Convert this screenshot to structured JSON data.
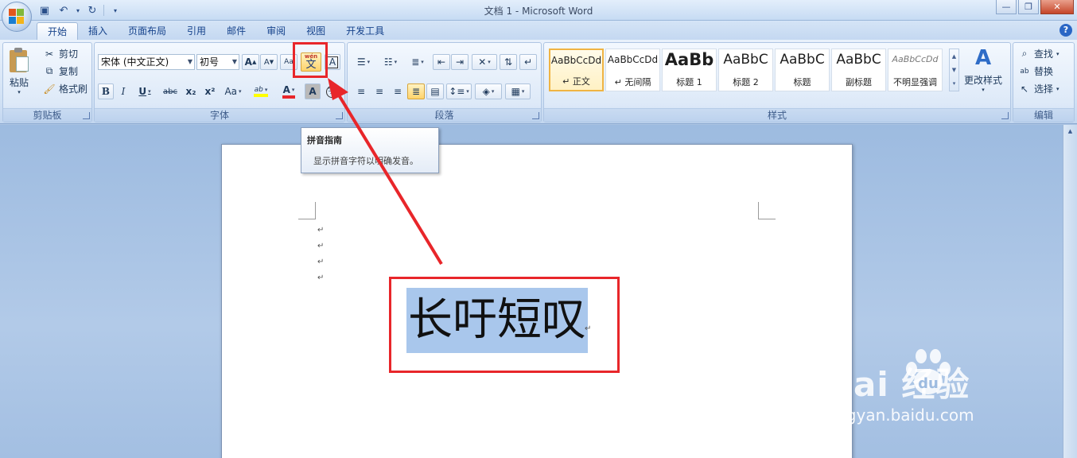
{
  "window": {
    "title": "文档 1 - Microsoft Word"
  },
  "qat": {
    "save": "save-icon",
    "undo": "undo-icon",
    "redo": "redo-icon"
  },
  "tabs": [
    "开始",
    "插入",
    "页面布局",
    "引用",
    "邮件",
    "审阅",
    "视图",
    "开发工具"
  ],
  "clipboard": {
    "paste_label": "粘贴",
    "cut_label": "剪切",
    "copy_label": "复制",
    "format_painter_label": "格式刷",
    "group_label": "剪贴板"
  },
  "font": {
    "font_name": "宋体 (中文正文)",
    "font_size": "初号",
    "grow_label": "A",
    "shrink_label": "A",
    "clear_label": "Aa",
    "phonetic_label": "wén",
    "phonetic_char": "文",
    "border_label": "A",
    "bold": "B",
    "italic": "I",
    "underline": "U",
    "strike": "abc",
    "subscript": "x₂",
    "superscript": "x²",
    "change_case": "Aa",
    "highlight": "ab",
    "font_color": "A",
    "shading": "A",
    "enclose": "字",
    "group_label": "字体"
  },
  "paragraph": {
    "group_label": "段落"
  },
  "styles": {
    "items": [
      {
        "sample": "AaBbCcDd",
        "name": "↵ 正文"
      },
      {
        "sample": "AaBbCcDd",
        "name": "↵ 无间隔"
      },
      {
        "sample": "AaBb",
        "name": "标题 1"
      },
      {
        "sample": "AaBbC",
        "name": "标题 2"
      },
      {
        "sample": "AaBbC",
        "name": "标题"
      },
      {
        "sample": "AaBbC",
        "name": "副标题"
      },
      {
        "sample": "AaBbCcDd",
        "name": "不明显强调"
      }
    ],
    "change_styles_label": "更改样式",
    "group_label": "样式"
  },
  "editing": {
    "find_label": "查找",
    "replace_label": "替换",
    "select_label": "选择",
    "group_label": "编辑"
  },
  "tooltip": {
    "title": "拼音指南",
    "body": "显示拼音字符以明确发音。"
  },
  "document": {
    "paragraph_mark": "↵",
    "selected_text": "长吁短叹"
  },
  "watermark": {
    "main": "Bai  经验",
    "du": "du",
    "sub": "jingyan.baidu.com"
  },
  "colors": {
    "annotation": "#e8262a",
    "selection": "#a9c7ec",
    "highlight_yellow": "#ffff00",
    "font_red": "#e8262a"
  }
}
